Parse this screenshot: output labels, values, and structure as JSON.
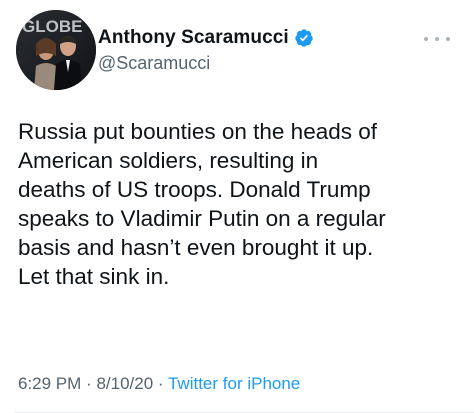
{
  "tweet": {
    "author": {
      "display_name": "Anthony Scaramucci",
      "handle": "@Scaramucci",
      "verified": true,
      "avatar_backdrop_text": "GLOBE"
    },
    "more_icon": "more-horizontal-icon",
    "text_lines": [
      "Russia put bounties on the heads of",
      "American soldiers, resulting in",
      "deaths of US troops. Donald Trump",
      "speaks to Vladimir Putin on a regular",
      "basis and hasn’t even brought it up.",
      "Let that sink in."
    ],
    "time": "6:29 PM",
    "separator": "·",
    "date": "8/10/20",
    "source": "Twitter for iPhone"
  },
  "colors": {
    "text_primary": "#0f1419",
    "text_secondary": "#536471",
    "accent": "#1d9bf0",
    "verified_badge": "#1d9bf0"
  }
}
